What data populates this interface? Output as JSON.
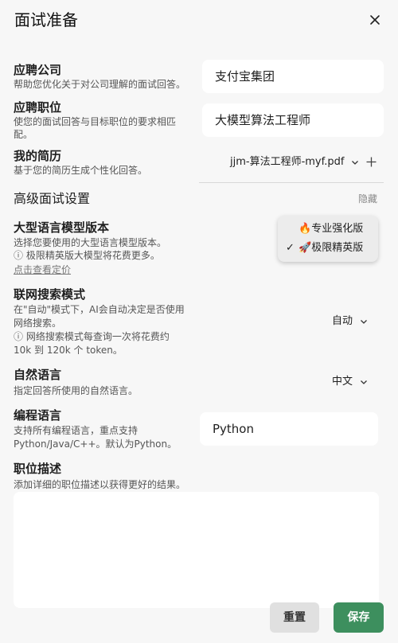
{
  "dialog": {
    "title": "面试准备"
  },
  "company": {
    "label": "应聘公司",
    "desc": "帮助您优化关于对公司理解的面试回答。",
    "value": "支付宝集团"
  },
  "position": {
    "label": "应聘职位",
    "desc_line1": "使您的面试回答与目标职位的要求相匹",
    "desc_line2": "配。",
    "value": "大模型算法工程师"
  },
  "resume": {
    "label": "我的简历",
    "desc": "基于您的简历生成个性化回答。",
    "file": "jjm-算法工程师-myf.pdf",
    "add_icon": "plus-icon"
  },
  "advanced": {
    "title": "高级面试设置",
    "hide": "隐藏"
  },
  "model": {
    "label": "大型语言模型版本",
    "desc_line1": "选择您要使用的大型语言模型版本。",
    "desc_line2": "ⓘ 极限精英版大模型将花费更多。",
    "link": "点击查看定价",
    "options": [
      {
        "icon": "🔥",
        "label": "专业强化版",
        "selected": false
      },
      {
        "icon": "🚀",
        "label": "极限精英版",
        "selected": true
      }
    ],
    "check": "✓"
  },
  "search": {
    "label": "联网搜索模式",
    "desc_line1": "在\"自动\"模式下，AI会自动决定是否使用",
    "desc_line2": "网络搜索。",
    "desc_line3": "ⓘ 网络搜索模式每查询一次将花费约",
    "desc_line4": "10k 到 120k 个 token。",
    "value": "自动"
  },
  "natural_lang": {
    "label": "自然语言",
    "desc": "指定回答所使用的自然语言。",
    "value": "中文"
  },
  "code_lang": {
    "label": "编程语言",
    "desc_line1": "支持所有编程语言，重点支持",
    "desc_line2": "Python/Java/C++。默认为Python。",
    "value": "Python"
  },
  "job_desc": {
    "label": "职位描述",
    "desc": "添加详细的职位描述以获得更好的结果。",
    "value": ""
  },
  "footer": {
    "reset": "重置",
    "save": "保存"
  },
  "colors": {
    "accent": "#3d8f5e",
    "background": "#f7f7f7"
  }
}
